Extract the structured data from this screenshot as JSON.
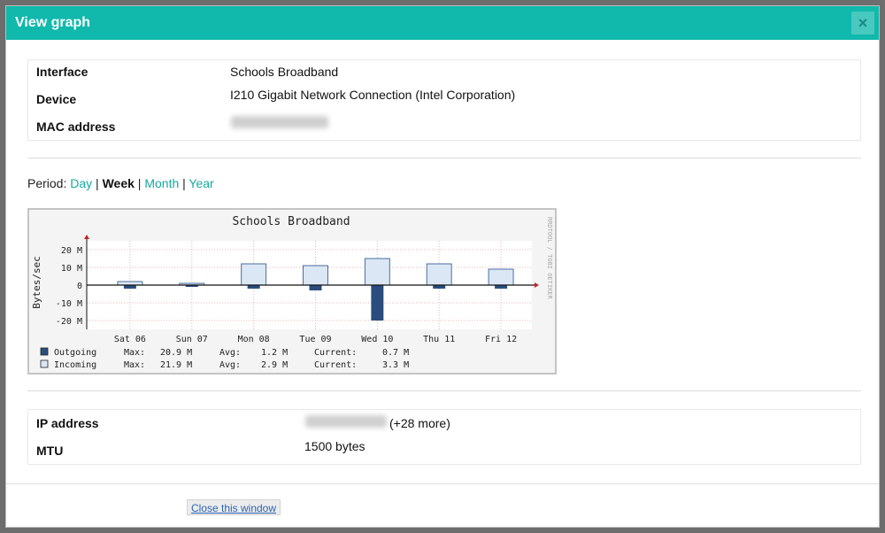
{
  "window": {
    "title": "View graph",
    "close_glyph": "×"
  },
  "info": {
    "interface_label": "Interface",
    "interface_value": "Schools Broadband",
    "device_label": "Device",
    "device_value": "I210 Gigabit Network Connection (Intel Corporation)",
    "mac_label": "MAC address"
  },
  "period": {
    "prefix": "Period:",
    "day": "Day",
    "week": "Week",
    "month": "Month",
    "year": "Year",
    "sep": "|",
    "selected": "Week"
  },
  "graph": {
    "title": "Schools Broadband",
    "ylabel": "Bytes/sec",
    "watermark": "RRDTOOL / TOBI OETIKER",
    "y_ticks": [
      "20 M",
      "10 M",
      "0",
      "-10 M",
      "-20 M"
    ],
    "x_ticks": [
      "Sat 06",
      "Sun 07",
      "Mon 08",
      "Tue 09",
      "Wed 10",
      "Thu 11",
      "Fri 12"
    ],
    "legend": [
      {
        "name": "Outgoing",
        "max_label": "Max:",
        "max": "20.9 M",
        "avg_label": "Avg:",
        "avg": "1.2 M",
        "cur_label": "Current:",
        "cur": "0.7 M",
        "color": "#2a4d7e"
      },
      {
        "name": "Incoming",
        "max_label": "Max:",
        "max": "21.9 M",
        "avg_label": "Avg:",
        "avg": "2.9 M",
        "cur_label": "Current:",
        "cur": "3.3 M",
        "color": "#dbe7f5"
      }
    ]
  },
  "chart_data": {
    "type": "area",
    "title": "Schools Broadband",
    "ylabel": "Bytes/sec",
    "ylim": [
      -25,
      25
    ],
    "x": [
      "Sat 06",
      "Sun 07",
      "Mon 08",
      "Tue 09",
      "Wed 10",
      "Thu 11",
      "Fri 12"
    ],
    "series": [
      {
        "name": "Incoming",
        "values": [
          2,
          1,
          12,
          11,
          15,
          12,
          9
        ]
      },
      {
        "name": "Outgoing",
        "values": [
          -2,
          -1,
          -2,
          -3,
          -20,
          -2,
          -2
        ]
      }
    ]
  },
  "net": {
    "ip_label": "IP address",
    "ip_more": "(+28 more)",
    "mtu_label": "MTU",
    "mtu_value": "1500 bytes"
  },
  "footer": {
    "close_button": "Close this window"
  }
}
